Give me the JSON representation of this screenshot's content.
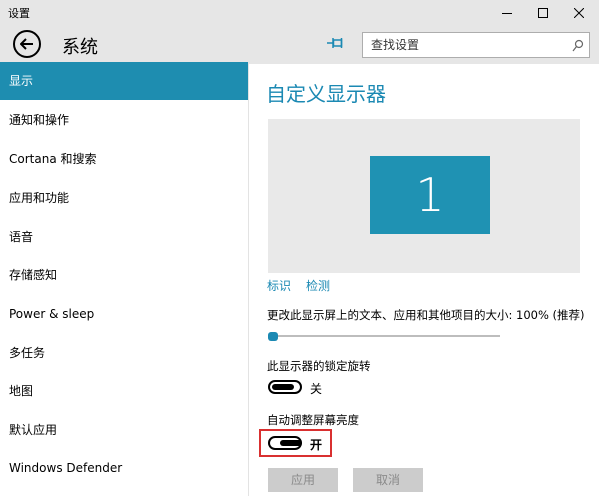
{
  "window": {
    "title": "设置"
  },
  "header": {
    "title": "系统",
    "search_placeholder": "查找设置"
  },
  "sidebar": {
    "items": [
      {
        "label": "显示",
        "active": true
      },
      {
        "label": "通知和操作"
      },
      {
        "label": "Cortana 和搜索"
      },
      {
        "label": "应用和功能"
      },
      {
        "label": "语音"
      },
      {
        "label": "存储感知"
      },
      {
        "label": "Power & sleep"
      },
      {
        "label": "多任务"
      },
      {
        "label": "地图"
      },
      {
        "label": "默认应用"
      },
      {
        "label": "Windows Defender"
      }
    ]
  },
  "main": {
    "title": "自定义显示器",
    "monitor_number": "1",
    "identify_link": "标识",
    "detect_link": "检测",
    "scale_label": "更改此显示屏上的文本、应用和其他项目的大小: 100% (推荐)",
    "scale_value_percent": 100,
    "rotation_lock": {
      "label": "此显示器的锁定旋转",
      "state": "关"
    },
    "auto_brightness": {
      "label": "自动调整屏幕亮度",
      "state": "开"
    },
    "apply_button": "应用",
    "cancel_button": "取消"
  },
  "colors": {
    "accent": "#1b89b3",
    "highlight": "#d93030",
    "titlebar": "#e6e6e6"
  }
}
